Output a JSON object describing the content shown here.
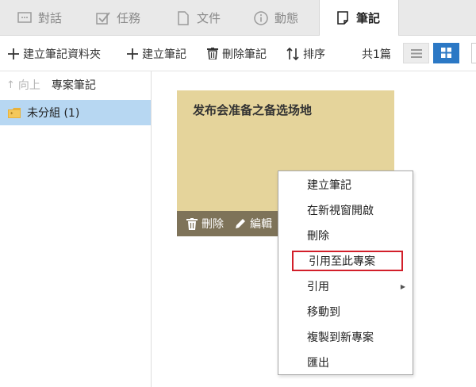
{
  "tabs": [
    {
      "label": "對話",
      "icon": "chat-icon",
      "active": false
    },
    {
      "label": "任務",
      "icon": "task-checkbox-icon",
      "active": false
    },
    {
      "label": "文件",
      "icon": "document-icon",
      "active": false
    },
    {
      "label": "動態",
      "icon": "info-icon",
      "active": false
    },
    {
      "label": "筆記",
      "icon": "note-icon",
      "active": true
    }
  ],
  "toolbar": {
    "new_folder": "建立筆記資料夾",
    "new_note": "建立筆記",
    "delete_note": "刪除筆記",
    "sort": "排序",
    "count": "共1篇"
  },
  "sidebar": {
    "up_label": "向上",
    "current": "專案筆記",
    "folders": [
      {
        "label": "未分組 (1)",
        "selected": true
      }
    ]
  },
  "note": {
    "title": "发布会准备之备选场地",
    "delete_label": "刪除",
    "edit_label": "編輯",
    "color": "#e5d49b"
  },
  "context_menu": {
    "items": [
      {
        "label": "建立筆記"
      },
      {
        "label": "在新視窗開啟"
      },
      {
        "label": "刪除"
      },
      {
        "label": "引用至此專案",
        "highlighted": true
      },
      {
        "label": "引用",
        "submenu": true
      },
      {
        "label": "移動到"
      },
      {
        "label": "複製到新專案"
      },
      {
        "label": "匯出"
      }
    ]
  },
  "colors": {
    "accent": "#2b78c5",
    "selection": "#b7d7f2",
    "highlight_border": "#d21f2a"
  }
}
